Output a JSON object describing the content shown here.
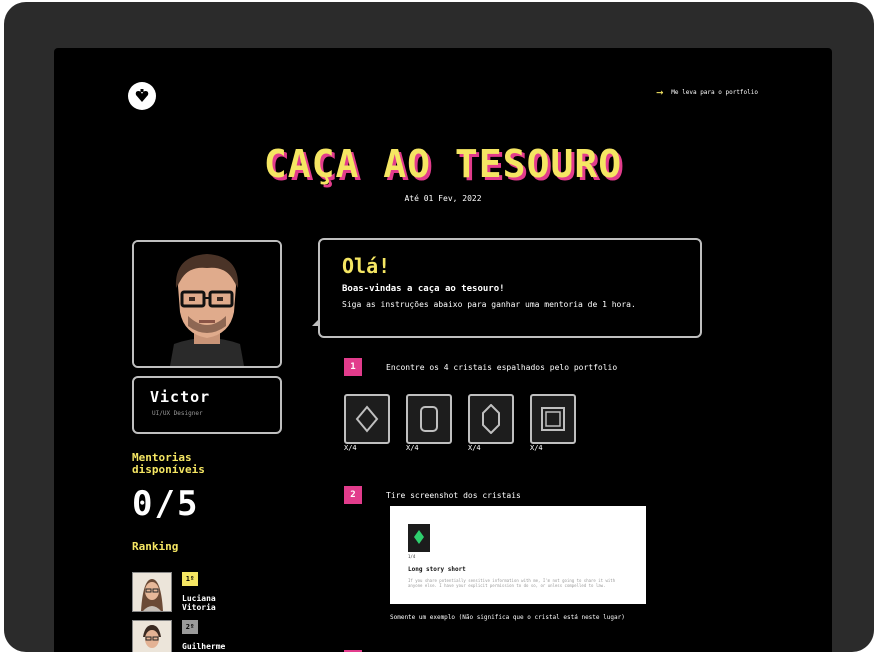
{
  "header": {
    "link_text": "Me leva para o portfolio"
  },
  "title": "CAÇA AO TESOURO",
  "date": "Até 01 Fev, 2022",
  "profile": {
    "name": "Victor",
    "role": "UI/UX Designer"
  },
  "mentorias": {
    "label": "Mentorias disponíveis",
    "count": "0/5"
  },
  "ranking": {
    "label": "Ranking",
    "items": [
      {
        "badge": "1º",
        "name": "Luciana Vitoria",
        "badge_color": "#f5e663"
      },
      {
        "badge": "2º",
        "name": "Guilherme",
        "badge_color": "#9a9a9a"
      }
    ]
  },
  "greeting": {
    "heading": "Olá!",
    "line1": "Boas-vindas a caça ao tesouro!",
    "line2": "Siga as instruções abaixo para ganhar uma mentoria de 1 hora."
  },
  "steps": [
    {
      "number": "1",
      "text": "Encontre os 4 cristais espalhados pelo portfolio"
    },
    {
      "number": "2",
      "text": "Tire screenshot dos cristais"
    }
  ],
  "crystals": [
    {
      "icon": "crystal-diamond-icon",
      "label": "X/4"
    },
    {
      "icon": "crystal-rounded-icon",
      "label": "X/4"
    },
    {
      "icon": "crystal-tall-icon",
      "label": "X/4"
    },
    {
      "icon": "crystal-square-icon",
      "label": "X/4"
    }
  ],
  "screenshot_example": {
    "tile_label": "1/4",
    "title": "Long story short",
    "paragraph": "If you share potentially sensitive information with me, I'm not going to share it with anyone else. I have your explicit permission to do so, or unless compelled to law."
  },
  "note": "Somente um exemplo (Não significa que o cristal está neste lugar)",
  "colors": {
    "accent_yellow": "#f5e663",
    "accent_pink": "#e23c8c",
    "background": "#000000",
    "frame": "#2b2b2b"
  }
}
